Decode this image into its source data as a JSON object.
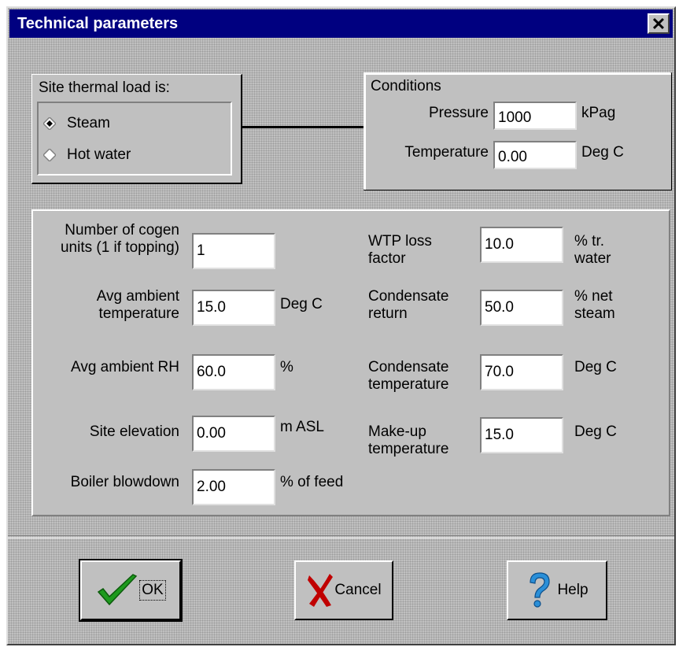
{
  "window": {
    "title": "Technical parameters",
    "close_glyph": "✕"
  },
  "thermal_load": {
    "label": "Site thermal load is:",
    "options": [
      {
        "label": "Steam",
        "selected": true
      },
      {
        "label": "Hot water",
        "selected": false
      }
    ]
  },
  "conditions": {
    "label": "Conditions",
    "pressure": {
      "label": "Pressure",
      "value": "1000",
      "unit": "kPag"
    },
    "temperature": {
      "label": "Temperature",
      "value": "0.00",
      "unit": "Deg C"
    }
  },
  "params_left": [
    {
      "label_lines": [
        "Number of cogen",
        "units (1 if topping)"
      ],
      "value": "1",
      "unit": ""
    },
    {
      "label_lines": [
        "Avg ambient",
        "temperature"
      ],
      "value": "15.0",
      "unit": "Deg C"
    },
    {
      "label_lines": [
        "Avg ambient RH"
      ],
      "value": "60.0",
      "unit": "%"
    },
    {
      "label_lines": [
        "Site elevation"
      ],
      "value": "0.00",
      "unit": "m ASL"
    },
    {
      "label_lines": [
        "Boiler blowdown"
      ],
      "value": "2.00",
      "unit": "% of feed"
    }
  ],
  "params_right": [
    {
      "label_lines": [
        "WTP loss",
        "factor"
      ],
      "value": "10.0",
      "unit_lines": [
        "% tr.",
        "water"
      ]
    },
    {
      "label_lines": [
        "Condensate",
        "return"
      ],
      "value": "50.0",
      "unit_lines": [
        "% net",
        "steam"
      ]
    },
    {
      "label_lines": [
        "Condensate",
        "temperature"
      ],
      "value": "70.0",
      "unit_lines": [
        "Deg C"
      ]
    },
    {
      "label_lines": [
        "Make-up",
        "temperature"
      ],
      "value": "15.0",
      "unit_lines": [
        "Deg C"
      ]
    }
  ],
  "buttons": {
    "ok": {
      "label": "OK",
      "icon": "checkmark-icon"
    },
    "cancel": {
      "label": "Cancel",
      "icon": "x-mark-icon"
    },
    "help": {
      "label": "Help",
      "icon": "question-mark-icon"
    }
  },
  "colors": {
    "titlebar": "#000080",
    "ok_check": "#1e9a1e",
    "cancel_x": "#c00000",
    "help_q": "#2a8fd8"
  }
}
